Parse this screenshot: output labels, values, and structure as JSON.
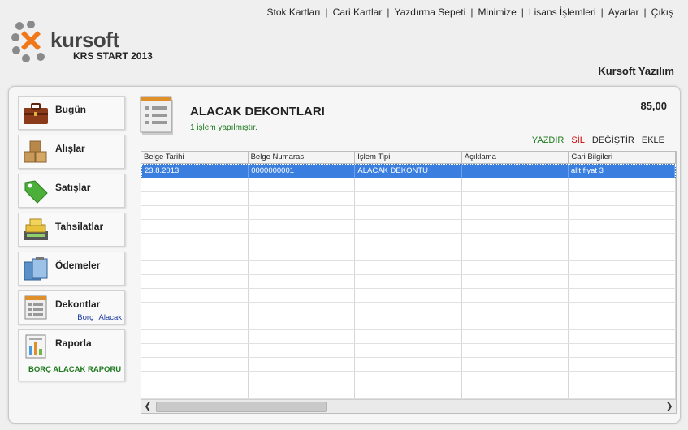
{
  "topmenu": {
    "items": [
      "Stok Kartları",
      "Cari Kartlar",
      "Yazdırma Sepeti",
      "Minimize",
      "Lisans İşlemleri",
      "Ayarlar",
      "Çıkış"
    ],
    "separator": "|"
  },
  "logo": {
    "name": "kursoft",
    "subtitle": "KRS START 2013"
  },
  "company": "Kursoft Yazılım",
  "sidebar": {
    "items": [
      {
        "label": "Bugün",
        "icon": "briefcase-icon"
      },
      {
        "label": "Alışlar",
        "icon": "boxes-icon"
      },
      {
        "label": "Satışlar",
        "icon": "price-tag-icon"
      },
      {
        "label": "Tahsilatlar",
        "icon": "cash-register-icon"
      },
      {
        "label": "Ödemeler",
        "icon": "payment-clipboard-icon"
      },
      {
        "label": "Dekontlar",
        "icon": "document-icon",
        "sub": [
          "Borç",
          "Alacak"
        ]
      },
      {
        "label": "Raporla",
        "icon": "report-icon",
        "link": "BORÇ ALACAK RAPORU"
      }
    ]
  },
  "content": {
    "title": "ALACAK DEKONTLARI",
    "status": "1 işlem yapılmıştır.",
    "total": "85,00",
    "actions": {
      "print": "YAZDIR",
      "delete": "SİL",
      "edit": "DEĞİŞTİR",
      "add": "EKLE"
    }
  },
  "grid": {
    "columns": [
      "Belge Tarihi",
      "Belge Numarası",
      "İşlem Tipi",
      "Açıklama",
      "Cari Bilgileri"
    ],
    "rows": [
      [
        "23.8.2013",
        "0000000001",
        "ALACAK DEKONTU",
        "",
        "allt fiyat 3"
      ]
    ],
    "empty_rows": 16
  },
  "colors": {
    "accent_green": "#1f7a1f",
    "delete_red": "#d00000",
    "selection_blue": "#3a7fe0",
    "logo_orange": "#f07818"
  }
}
